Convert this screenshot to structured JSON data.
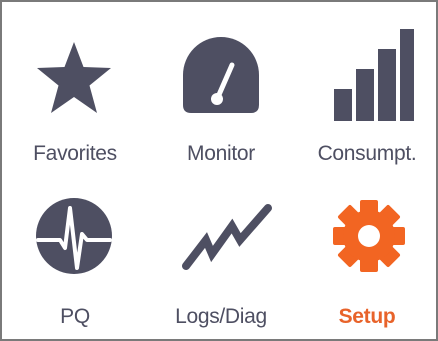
{
  "colors": {
    "icon": "#4e4f62",
    "accent": "#f26522",
    "label": "#4e4f62",
    "active_label": "#e8632a",
    "border": "#7a7a7a"
  },
  "tiles": [
    {
      "label": "Favorites",
      "icon": "star-icon",
      "active": false
    },
    {
      "label": "Monitor",
      "icon": "gauge-icon",
      "active": false
    },
    {
      "label": "Consumpt.",
      "icon": "signal-bars-icon",
      "active": false
    },
    {
      "label": "PQ",
      "icon": "heartbeat-icon",
      "active": false
    },
    {
      "label": "Logs/Diag",
      "icon": "trend-line-icon",
      "active": false
    },
    {
      "label": "Setup",
      "icon": "gear-icon",
      "active": true
    }
  ]
}
